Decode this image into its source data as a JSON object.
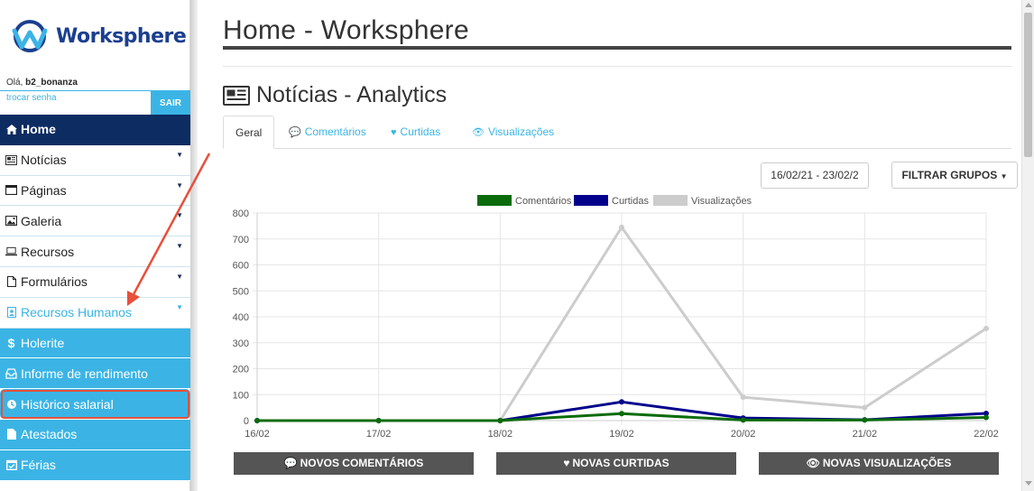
{
  "brand": {
    "name": "Worksphere"
  },
  "user": {
    "greeting": "Olá, ",
    "username": "b2_bonanza",
    "change_password": "trocar senha",
    "logout": "SAIR"
  },
  "menu": [
    {
      "label": "Home",
      "icon": "home-icon"
    },
    {
      "label": "Notícias",
      "icon": "newspaper-icon"
    },
    {
      "label": "Páginas",
      "icon": "window-icon"
    },
    {
      "label": "Galeria",
      "icon": "image-icon"
    },
    {
      "label": "Recursos",
      "icon": "laptop-icon"
    },
    {
      "label": "Formulários",
      "icon": "file-icon"
    },
    {
      "label": "Recursos Humanos",
      "icon": "id-badge-icon"
    },
    {
      "label": "Holerite",
      "icon": "dollar-icon"
    },
    {
      "label": "Informe de rendimento",
      "icon": "inbox-icon"
    },
    {
      "label": "Histórico salarial",
      "icon": "history-icon"
    },
    {
      "label": "Atestados",
      "icon": "document-icon"
    },
    {
      "label": "Férias",
      "icon": "calendar-check-icon"
    }
  ],
  "page": {
    "title": "Home - Worksphere",
    "section_title": "Notícias - Analytics"
  },
  "tabs": [
    {
      "label": "Geral",
      "icon": ""
    },
    {
      "label": "Comentários",
      "icon": "comment-icon"
    },
    {
      "label": "Curtidas",
      "icon": "heart-icon"
    },
    {
      "label": "Visualizações",
      "icon": "eye-icon"
    }
  ],
  "filters": {
    "date_range": "16/02/21 - 23/02/2",
    "group_button": "FILTRAR GRUPOS"
  },
  "chart_data": {
    "type": "line",
    "x": [
      "16/02",
      "17/02",
      "18/02",
      "19/02",
      "20/02",
      "21/02",
      "22/02"
    ],
    "ylim": [
      0,
      800
    ],
    "yticks": [
      0,
      100,
      200,
      300,
      400,
      500,
      600,
      700,
      800
    ],
    "grid": true,
    "legend": "top-center",
    "series": [
      {
        "name": "Comentários",
        "color": "#0b6b0b",
        "values": [
          0,
          0,
          0,
          27,
          2,
          2,
          12
        ]
      },
      {
        "name": "Curtidas",
        "color": "#00008b",
        "values": [
          0,
          0,
          0,
          72,
          10,
          3,
          28
        ]
      },
      {
        "name": "Visualizações",
        "color": "#cccccc",
        "values": [
          0,
          0,
          0,
          745,
          90,
          50,
          355
        ]
      }
    ]
  },
  "stats": [
    {
      "label": "NOVOS COMENTÁRIOS",
      "icon": "comment-icon"
    },
    {
      "label": "NOVAS CURTIDAS",
      "icon": "heart-icon"
    },
    {
      "label": "NOVAS VISUALIZAÇÕES",
      "icon": "eye-icon"
    }
  ],
  "colors": {
    "sidebar_dark": "#0d2c62",
    "accent": "#3bb4e5",
    "highlight": "#e8503a"
  }
}
